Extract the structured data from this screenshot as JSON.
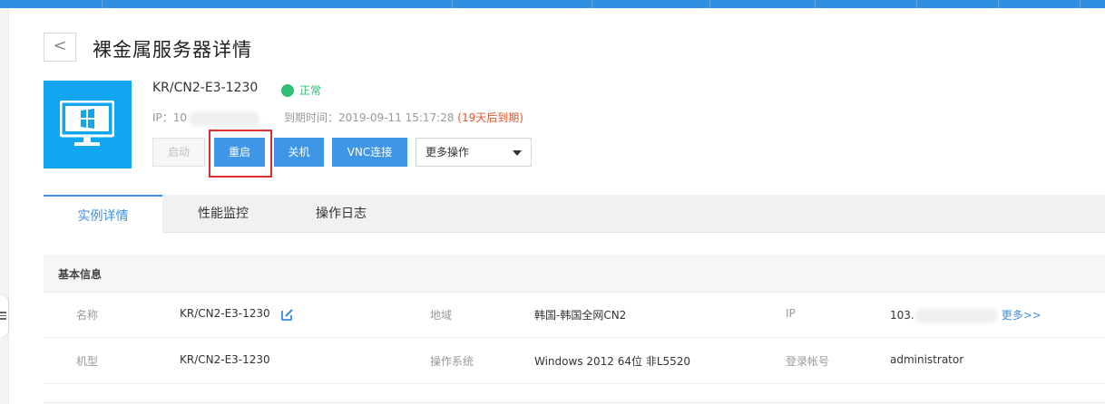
{
  "header": {
    "back_label": "<",
    "title": "裸金属服务器详情"
  },
  "server": {
    "name": "KR/CN2-E3-1230",
    "status": "正常",
    "ip_label": "IP：",
    "ip_partial": "10",
    "expire_label": "到期时间：",
    "expire_time": "2019-09-11 15:17:28",
    "expire_note": "(19天后到期)"
  },
  "actions": {
    "start": "启动",
    "restart": "重启",
    "shutdown": "关机",
    "vnc": "VNC连接",
    "more": "更多操作"
  },
  "tabs": [
    {
      "label": "实例详情",
      "active": true
    },
    {
      "label": "性能监控",
      "active": false
    },
    {
      "label": "操作日志",
      "active": false
    }
  ],
  "section": {
    "title": "基本信息"
  },
  "info_rows": [
    [
      {
        "label": "名称",
        "value": "KR/CN2-E3-1230"
      },
      {
        "label": "地域",
        "value": "韩国-韩国全网CN2"
      },
      {
        "label": "IP",
        "value": "103.",
        "link": "更多>>"
      }
    ],
    [
      {
        "label": "机型",
        "value": "KR/CN2-E3-1230"
      },
      {
        "label": "操作系统",
        "value": "Windows 2012 64位 非L5520"
      },
      {
        "label": "登录帐号",
        "value": "administrator"
      }
    ]
  ],
  "colors": {
    "accent": "#3e97e6",
    "tile": "#11a7f0",
    "status_green": "#2fbf71",
    "warn": "#e4572e",
    "highlight": "#e02d2d"
  },
  "icons": {
    "back": "chevron-left-icon",
    "server": "monitor-windows-icon",
    "status": "status-dot-icon",
    "edit": "edit-icon",
    "caret": "caret-down-icon"
  }
}
